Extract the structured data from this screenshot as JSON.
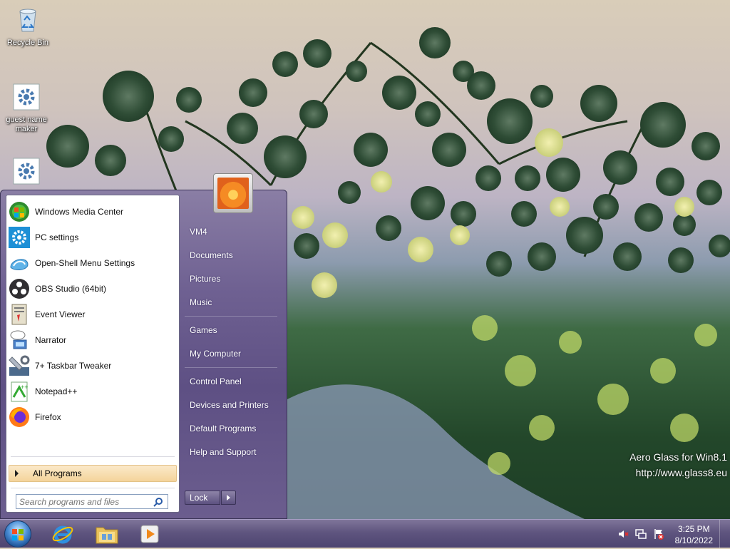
{
  "desktop": {
    "icons": [
      {
        "label": "Recycle Bin",
        "icon": "recycle-bin-icon"
      },
      {
        "label": "guest name maker",
        "icon": "gear-app-icon"
      },
      {
        "label": "",
        "icon": "gear-app-icon"
      }
    ],
    "watermark": {
      "line1": "Aero Glass for Win8.1",
      "line2": "http://www.glass8.eu"
    }
  },
  "start_menu": {
    "pinned_programs": [
      {
        "label": "Windows Media Center",
        "icon": "windows-media-center-icon"
      },
      {
        "label": "PC settings",
        "icon": "pc-settings-icon"
      },
      {
        "label": "Open-Shell Menu Settings",
        "icon": "open-shell-icon"
      },
      {
        "label": "OBS Studio (64bit)",
        "icon": "obs-studio-icon"
      },
      {
        "label": "Event Viewer",
        "icon": "event-viewer-icon"
      },
      {
        "label": "Narrator",
        "icon": "narrator-icon"
      },
      {
        "label": "7+ Taskbar Tweaker",
        "icon": "taskbar-tweaker-icon"
      },
      {
        "label": "Notepad++",
        "icon": "notepad-plus-plus-icon"
      },
      {
        "label": "Firefox",
        "icon": "firefox-icon"
      }
    ],
    "all_programs_label": "All Programs",
    "search_placeholder": "Search programs and files",
    "right_items": [
      {
        "label": "VM4"
      },
      {
        "label": "Documents"
      },
      {
        "label": "Pictures"
      },
      {
        "label": "Music"
      },
      {
        "label": "Games"
      },
      {
        "label": "My Computer"
      },
      {
        "label": "Control Panel"
      },
      {
        "label": "Devices and Printers"
      },
      {
        "label": "Default Programs"
      },
      {
        "label": "Help and Support"
      }
    ],
    "lock_label": "Lock"
  },
  "taskbar": {
    "pinned": [
      {
        "icon": "internet-explorer-icon"
      },
      {
        "icon": "file-explorer-icon"
      },
      {
        "icon": "media-player-icon"
      }
    ],
    "tray": [
      {
        "icon": "volume-muted-icon"
      },
      {
        "icon": "network-icon"
      },
      {
        "icon": "action-center-flag-icon"
      }
    ],
    "clock": {
      "time": "3:25 PM",
      "date": "8/10/2022"
    }
  },
  "colors": {
    "accent": "#5e5084",
    "highlight": "#f4d49b"
  }
}
